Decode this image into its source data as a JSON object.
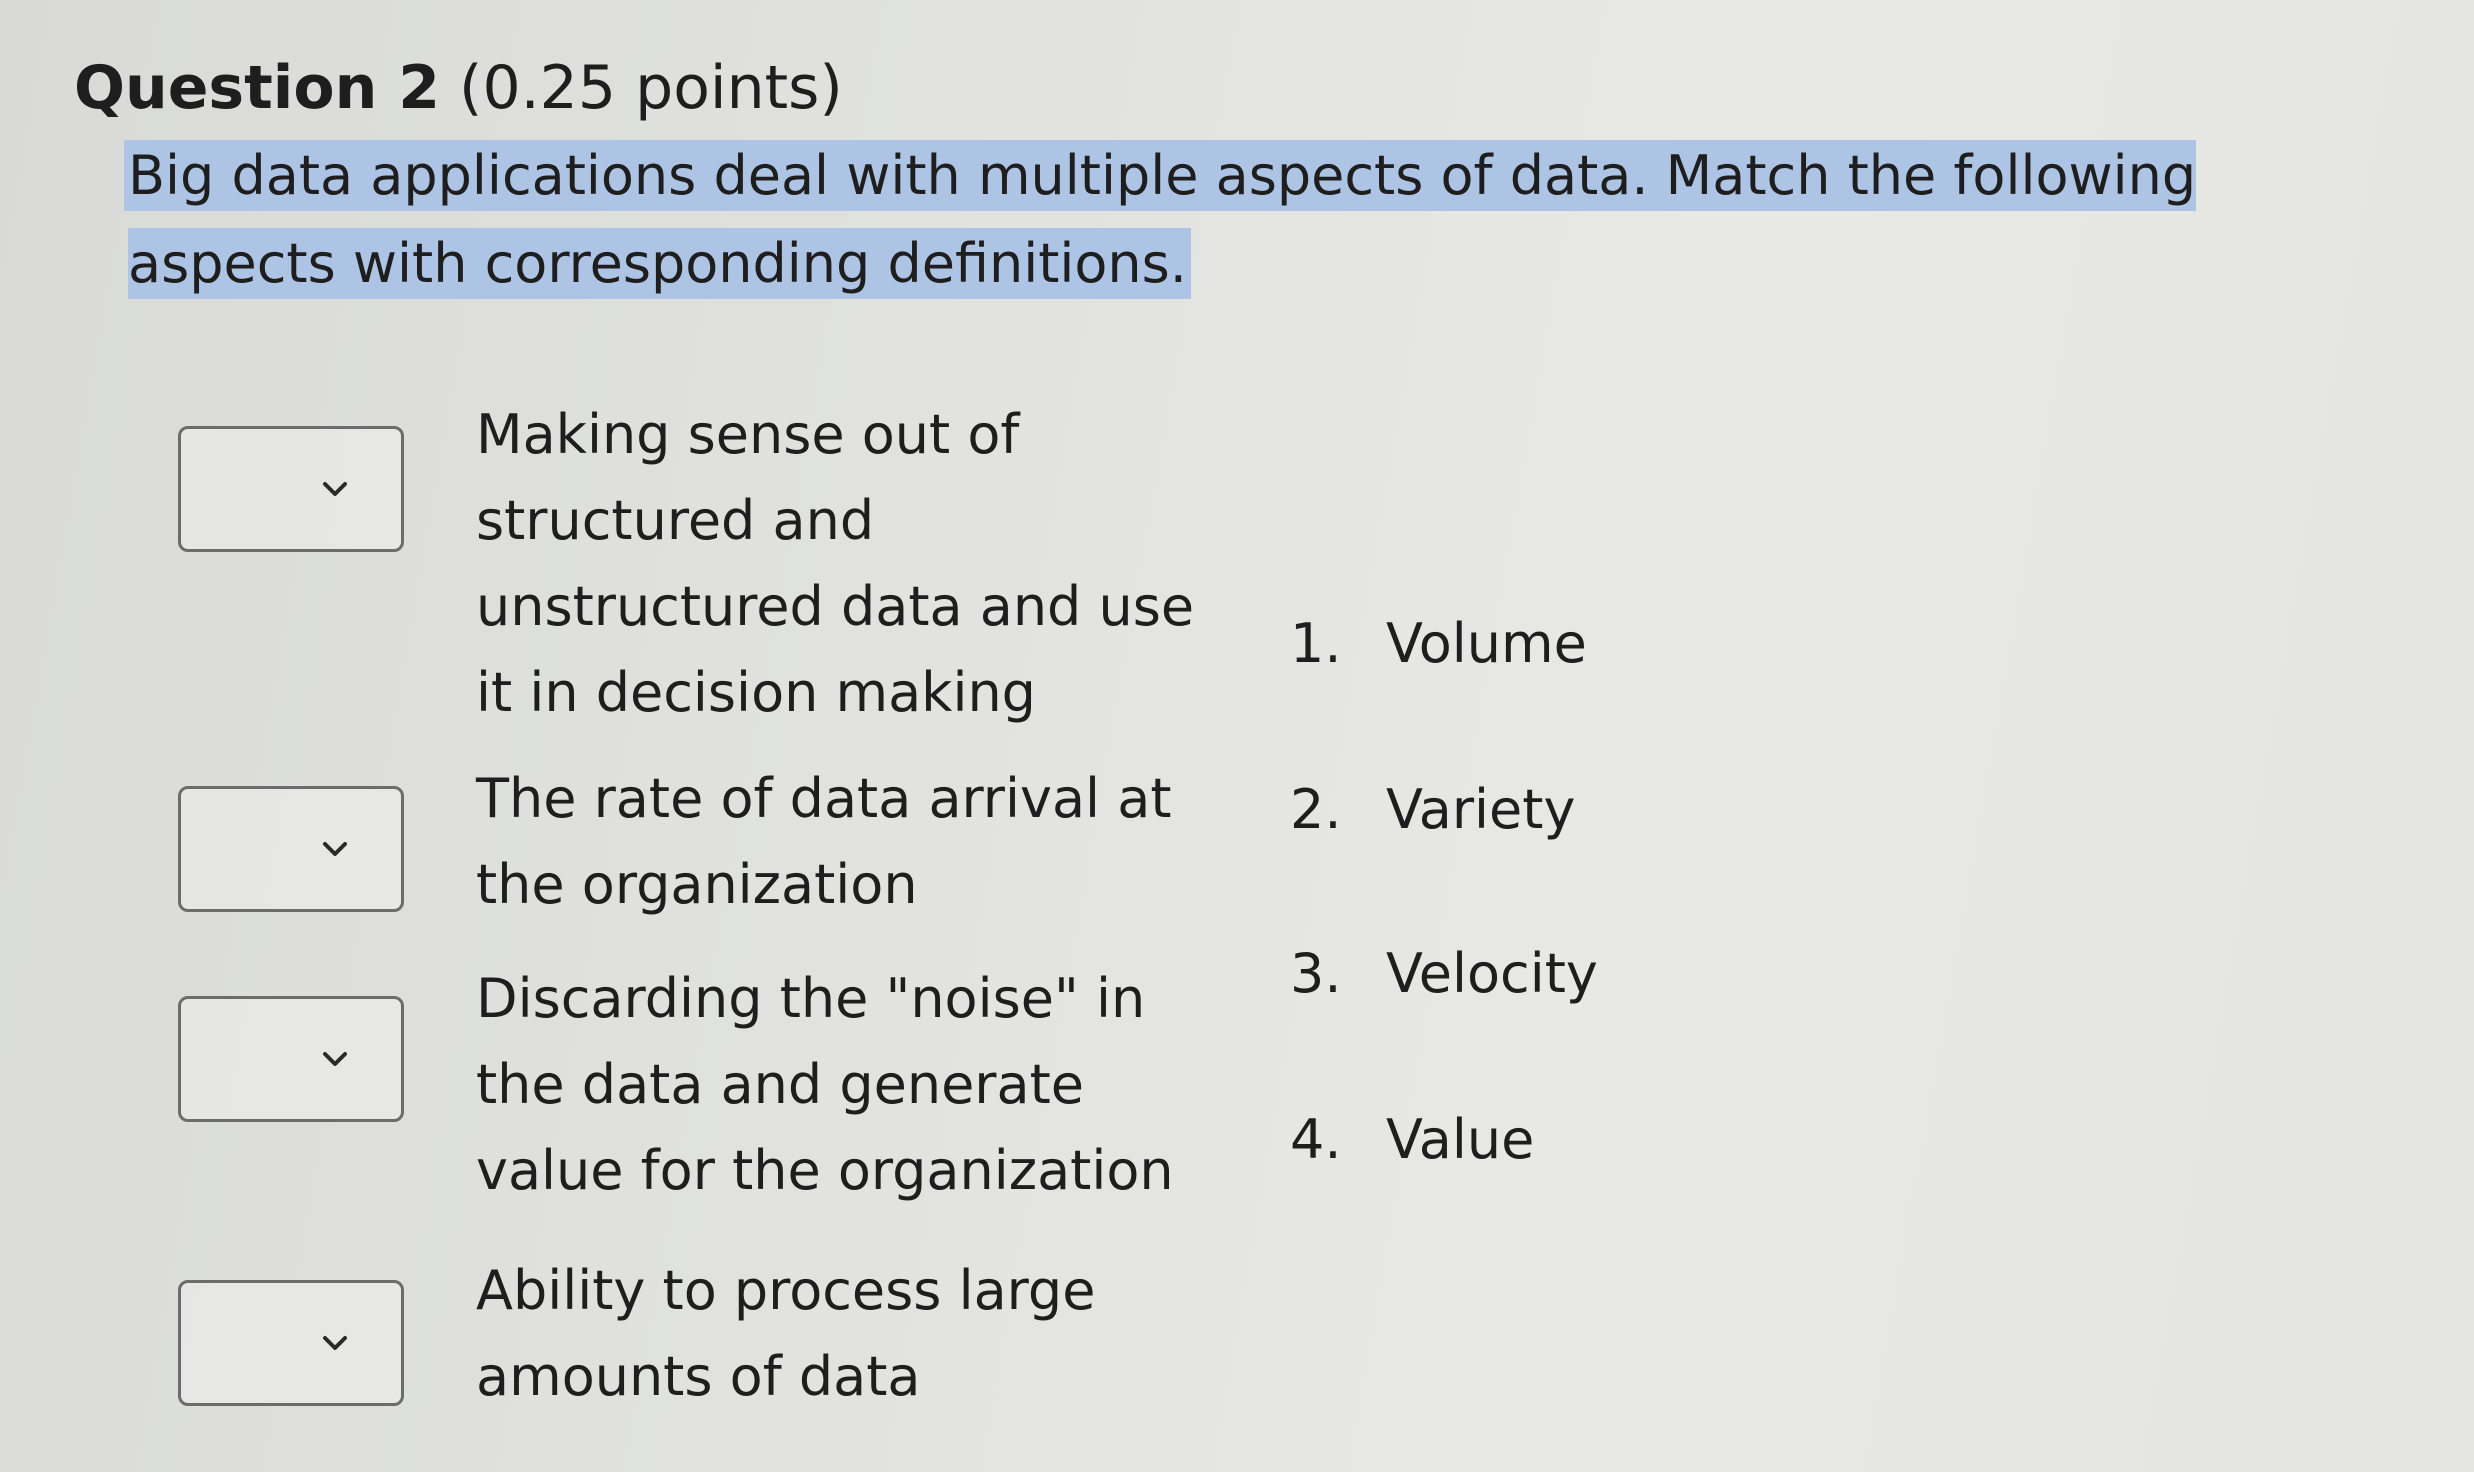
{
  "question": {
    "title": "Question 2",
    "points": "(0.25 points)",
    "prompt": "Big data applications deal with multiple aspects of data. Match the following aspects with corresponding definitions."
  },
  "matches": [
    {
      "definition": "Making sense out of structured and unstructured data and use it in decision making",
      "selected": ""
    },
    {
      "definition": "The rate of data arrival at the organization",
      "selected": ""
    },
    {
      "definition": "Discarding the \"noise\" in the data and generate value for the organization",
      "selected": ""
    },
    {
      "definition": "Ability to process large amounts of data",
      "selected": ""
    }
  ],
  "answers": [
    {
      "number": "1.",
      "label": "Volume"
    },
    {
      "number": "2.",
      "label": "Variety"
    },
    {
      "number": "3.",
      "label": "Velocity"
    },
    {
      "number": "4.",
      "label": "Value"
    }
  ],
  "icons": {
    "dropdown": "chevron-down-icon"
  }
}
